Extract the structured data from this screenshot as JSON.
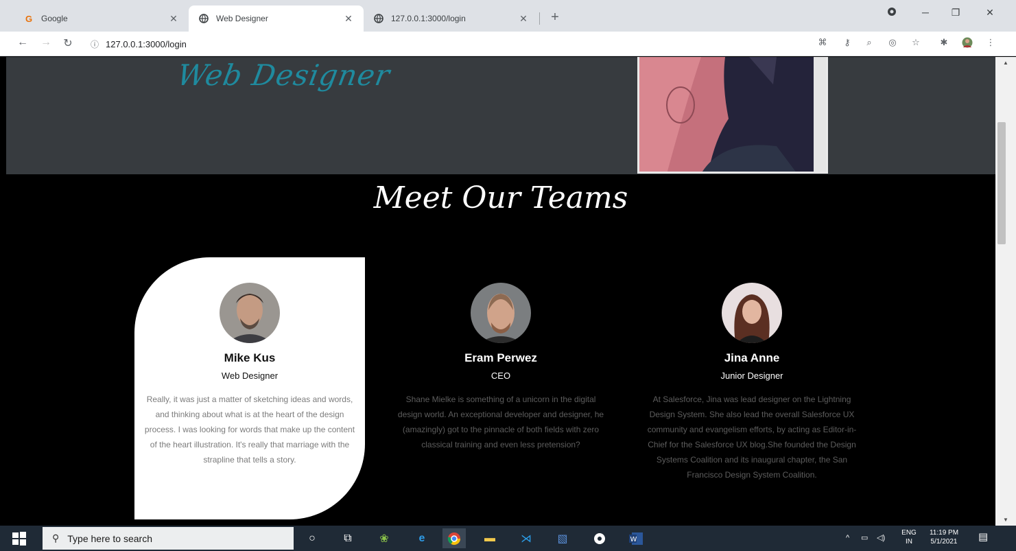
{
  "browser": {
    "tabs": [
      {
        "title": "Google",
        "icon": "google-g-icon",
        "active": false
      },
      {
        "title": "Web Designer",
        "icon": "globe-icon",
        "active": true
      },
      {
        "title": "127.0.0.1:3000/login",
        "icon": "globe-icon",
        "active": false
      }
    ],
    "url": "127.0.0.1:3000/login"
  },
  "hero": {
    "brand": "Web Designer"
  },
  "teams": {
    "title": "Meet Our Teams",
    "members": [
      {
        "name": "Mike Kus",
        "role": "Web Designer",
        "bio": "Really, it was just a matter of sketching ideas and words, and thinking about what is at the heart of the design process. I was looking for words that make up the content of the heart illustration. It's really that marriage with the strapline that tells a story."
      },
      {
        "name": "Eram Perwez",
        "role": "CEO",
        "bio": "Shane Mielke is something of a unicorn in the digital design world. An exceptional developer and designer, he (amazingly) got to the pinnacle of both fields with zero classical training and even less pretension?"
      },
      {
        "name": "Jina Anne",
        "role": "Junior Designer",
        "bio": "At Salesforce, Jina was lead designer on the Lightning Design System. She also lead the overall Salesforce UX community and evangelism efforts, by acting as Editor-in-Chief for the Salesforce UX blog.She founded the Design Systems Coalition and its inaugural chapter, the San Francisco Design System Coalition."
      }
    ]
  },
  "taskbar": {
    "search_placeholder": "Type here to search",
    "lang_line1": "ENG",
    "lang_line2": "IN",
    "time": "11:19 PM",
    "date": "5/1/2021"
  },
  "colors": {
    "hero_bg": "#373b3f",
    "brand_teal": "#1f8a9e",
    "page_bg": "#000000",
    "card_bg": "#ffffff"
  }
}
